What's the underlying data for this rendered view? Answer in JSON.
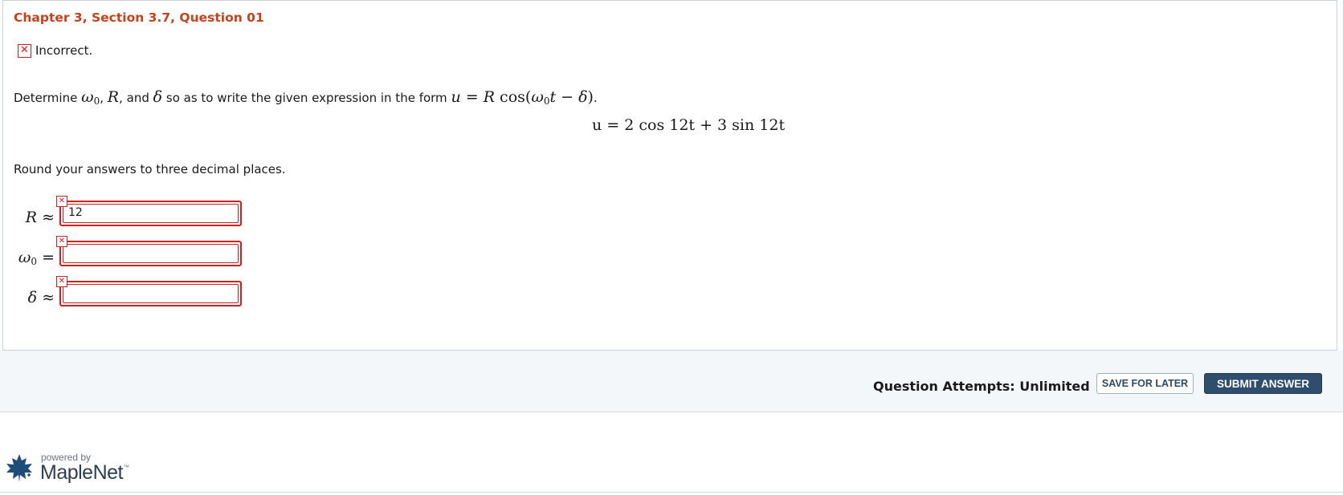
{
  "question": {
    "title": "Chapter 3, Section 3.7, Question 01",
    "feedback": "Incorrect.",
    "prompt_start": "Determine",
    "prompt_sep1": ",",
    "prompt_sep2": ", and",
    "prompt_mid": "so as to write the given expression in the form",
    "prompt_end": ".",
    "expression": "u = 2 cos 12t + 3 sin 12t",
    "instruction": "Round your answers to three decimal places."
  },
  "answers": [
    {
      "symbol": "R",
      "relation": "≈",
      "value": "12",
      "status": "incorrect"
    },
    {
      "symbol": "ω0",
      "relation": "=",
      "value": "",
      "status": "incorrect"
    },
    {
      "symbol": "δ",
      "relation": "≈",
      "value": "",
      "status": "incorrect"
    }
  ],
  "footer": {
    "attempts": "Question Attempts: Unlimited",
    "save_label": "SAVE FOR LATER",
    "submit_label": "SUBMIT ANSWER",
    "powered_by": "powered by",
    "brand": "MapleNet"
  },
  "colors": {
    "title": "#c4431c",
    "error": "#d21f1f",
    "submit_bg": "#2f4d6d"
  },
  "icons": {
    "feedback": "incorrect-x-icon",
    "logo": "maple-leaf-icon"
  }
}
